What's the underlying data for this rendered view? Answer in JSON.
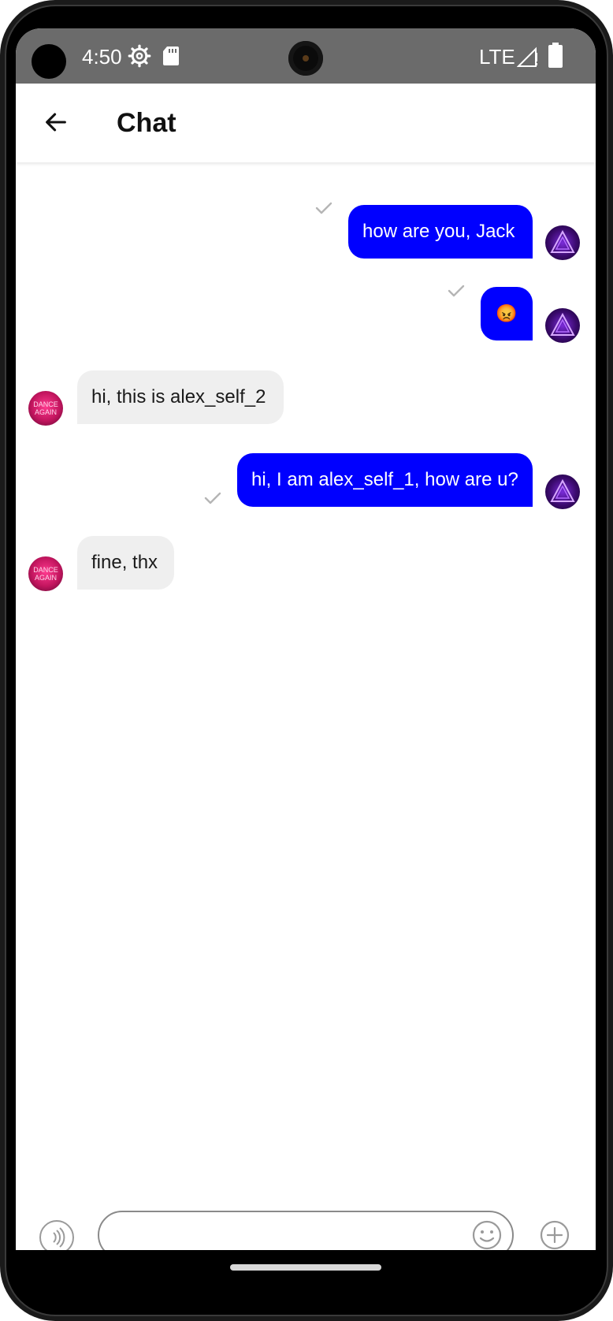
{
  "status_bar": {
    "time": "4:50",
    "network": "LTE",
    "icons": [
      "gear-icon",
      "sd-card-icon",
      "signal-icon",
      "battery-icon"
    ],
    "color": "#6b6b6b"
  },
  "app_bar": {
    "title": "Chat",
    "back_icon": "arrow-left-icon"
  },
  "colors": {
    "outgoing_bubble": "#0000ff",
    "incoming_bubble": "#efefef",
    "check": "#b5b5b5"
  },
  "messages": [
    {
      "direction": "outgoing",
      "text": "how are you, Jack",
      "sender": "alex_self_1",
      "status": "sent-check-icon"
    },
    {
      "direction": "outgoing",
      "text": "😡",
      "sender": "alex_self_1",
      "status": "sent-check-icon"
    },
    {
      "direction": "incoming",
      "text": "hi, this is alex_self_2",
      "sender": "alex_self_2"
    },
    {
      "direction": "outgoing",
      "text": "hi, I am alex_self_1, how are u?",
      "sender": "alex_self_1",
      "status": "sent-check-icon"
    },
    {
      "direction": "incoming",
      "text": "fine, thx",
      "sender": "alex_self_2"
    }
  ],
  "avatars": {
    "other_text_line1": "DANCE",
    "other_text_line2": "AGAIN"
  },
  "composer": {
    "placeholder": "",
    "value": "",
    "voice_icon": "voice-icon",
    "emoji_icon": "smiley-icon",
    "add_icon": "plus-circle-icon"
  }
}
